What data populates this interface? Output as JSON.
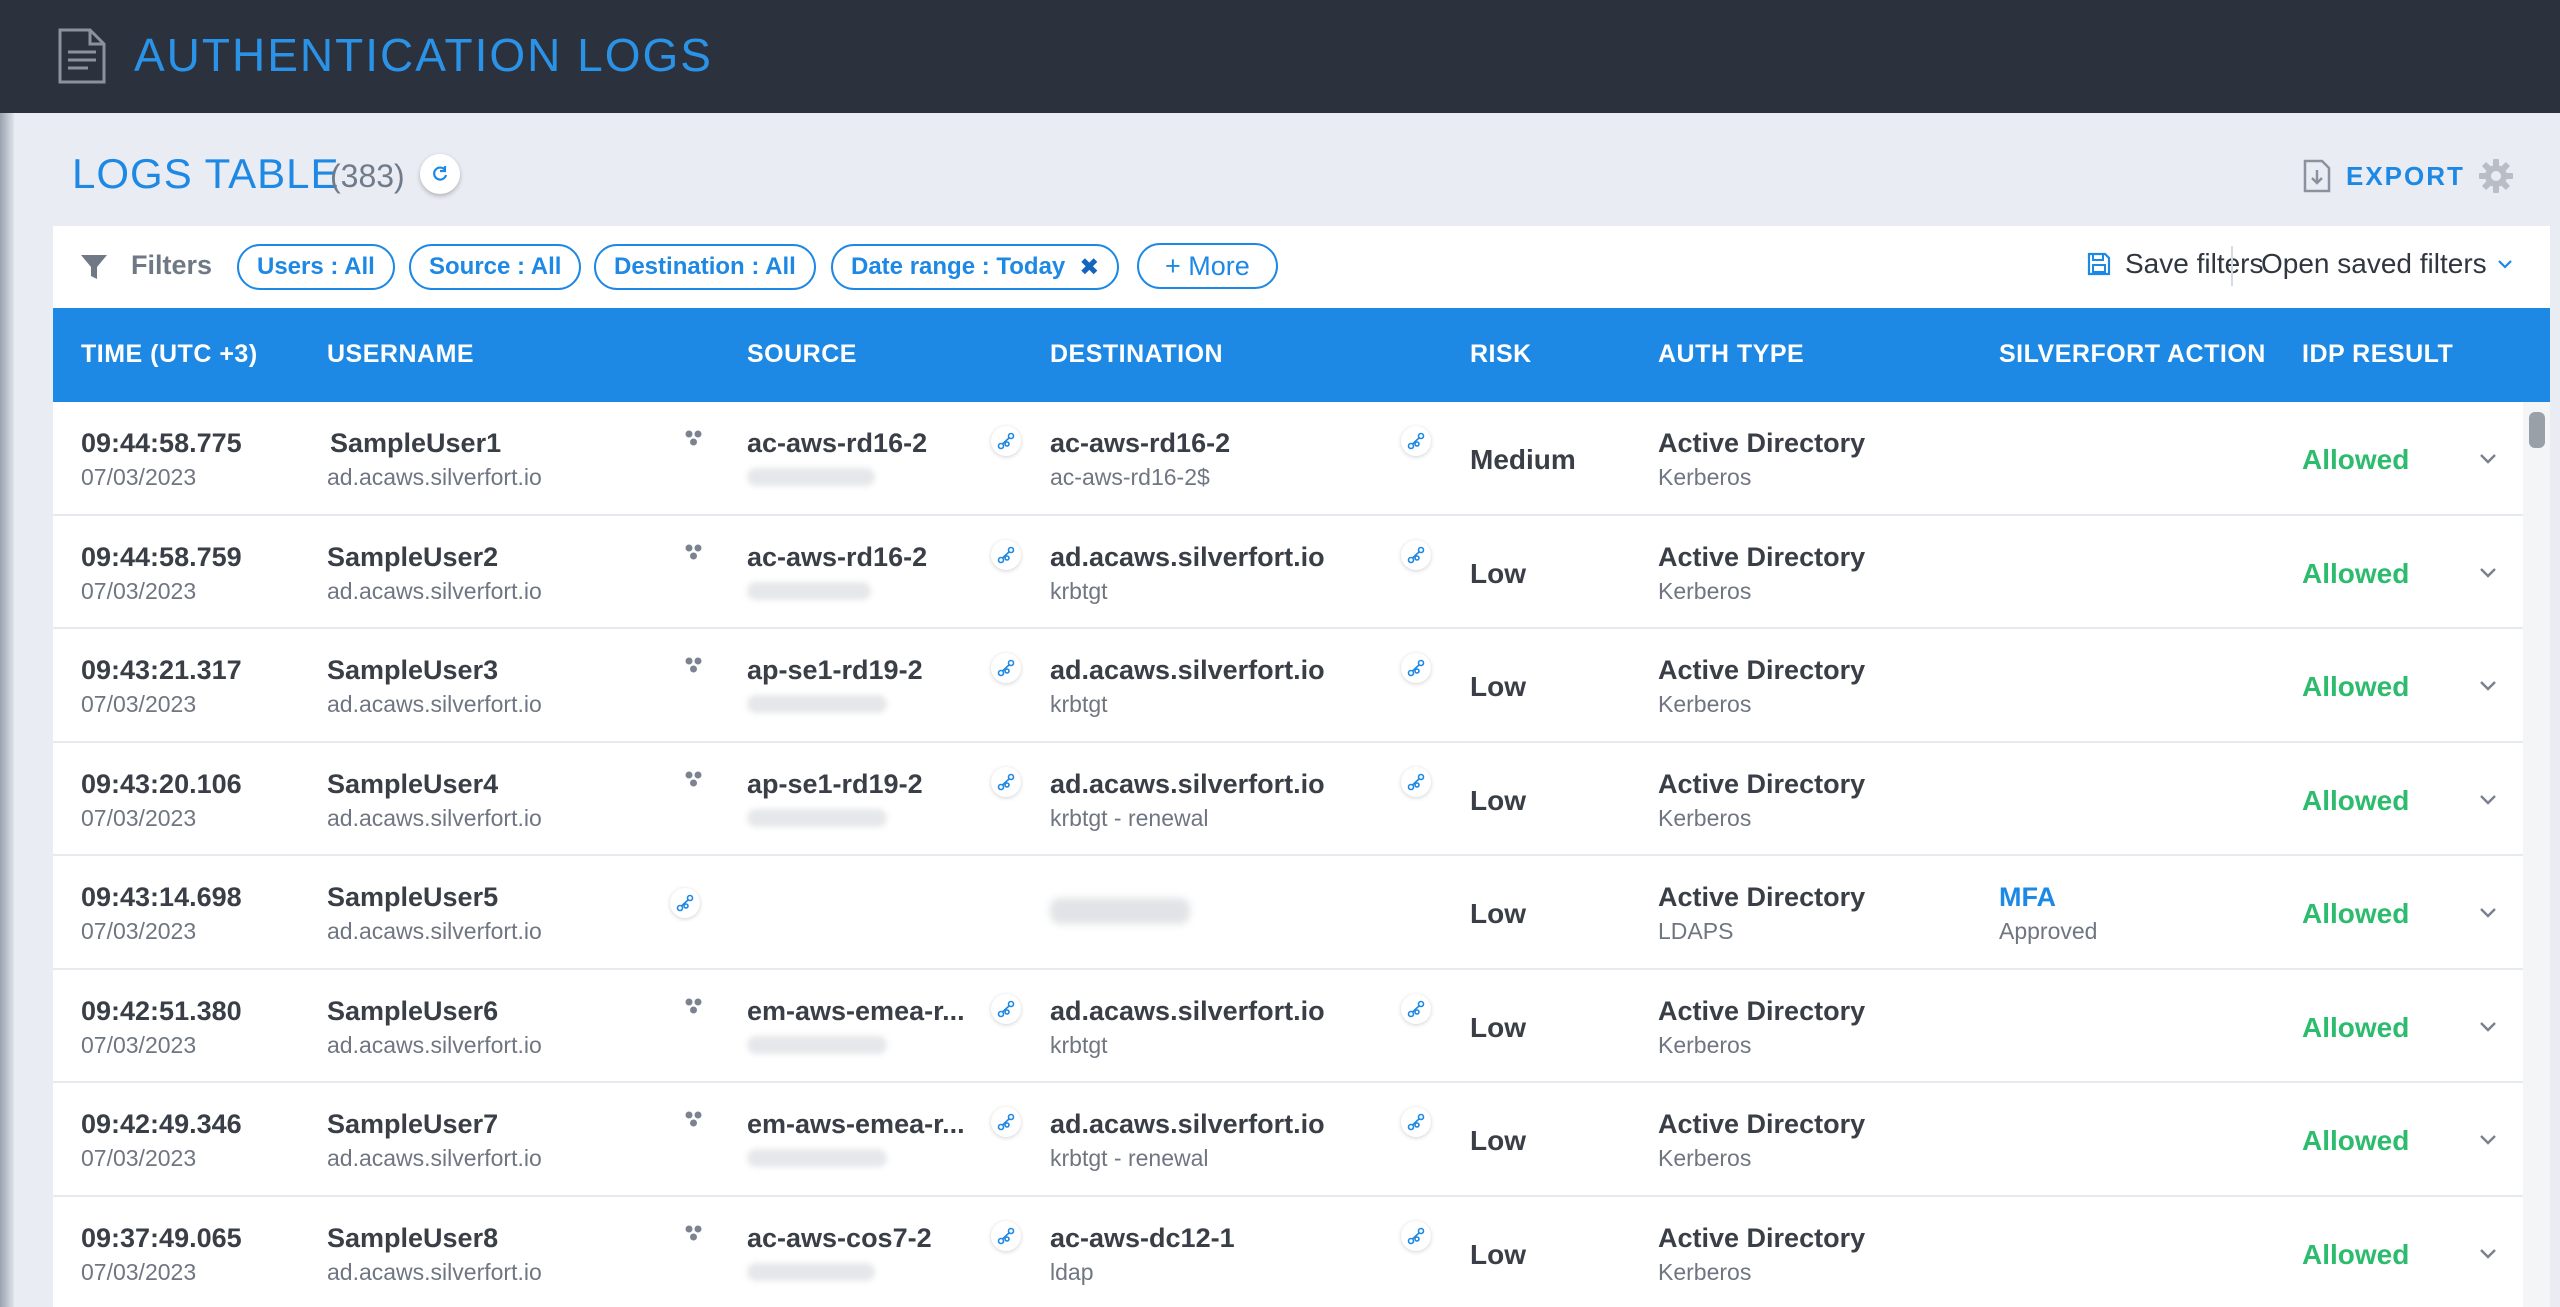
{
  "header": {
    "title": "AUTHENTICATION LOGS"
  },
  "logs": {
    "title": "LOGS TABLE",
    "count": "(383)",
    "export_label": "EXPORT"
  },
  "filters": {
    "label": "Filters",
    "chips": [
      {
        "label": "Users : All"
      },
      {
        "label": "Source : All"
      },
      {
        "label": "Destination : All"
      },
      {
        "label": "Date range : Today",
        "removable": true
      }
    ],
    "more_label": "+ More",
    "save_label": "Save filters",
    "open_saved_label": "Open saved filters"
  },
  "table": {
    "columns": [
      "TIME (UTC +3)",
      "USERNAME",
      "SOURCE",
      "DESTINATION",
      "RISK",
      "AUTH TYPE",
      "SILVERFORT ACTION",
      "IDP RESULT"
    ],
    "rows": [
      {
        "time": "09:44:58.775",
        "date": "07/03/2023",
        "user": "SampleUser1",
        "domain": "ad.acaws.silverfort.io",
        "source": "ac-aws-rd16-2",
        "dest": "ac-aws-rd16-2",
        "dest_sub": "ac-aws-rd16-2$",
        "risk": "Medium",
        "auth": "Active Directory",
        "auth_sub": "Kerberos",
        "action": "",
        "action_sub": "",
        "result": "Allowed"
      },
      {
        "time": "09:44:58.759",
        "date": "07/03/2023",
        "user": "SampleUser2",
        "domain": "ad.acaws.silverfort.io",
        "source": "ac-aws-rd16-2",
        "dest": "ad.acaws.silverfort.io",
        "dest_sub": "krbtgt",
        "risk": "Low",
        "auth": "Active Directory",
        "auth_sub": "Kerberos",
        "action": "",
        "action_sub": "",
        "result": "Allowed"
      },
      {
        "time": "09:43:21.317",
        "date": "07/03/2023",
        "user": "SampleUser3",
        "domain": "ad.acaws.silverfort.io",
        "source": "ap-se1-rd19-2",
        "dest": "ad.acaws.silverfort.io",
        "dest_sub": "krbtgt",
        "risk": "Low",
        "auth": "Active Directory",
        "auth_sub": "Kerberos",
        "action": "",
        "action_sub": "",
        "result": "Allowed"
      },
      {
        "time": "09:43:20.106",
        "date": "07/03/2023",
        "user": "SampleUser4",
        "domain": "ad.acaws.silverfort.io",
        "source": "ap-se1-rd19-2",
        "dest": "ad.acaws.silverfort.io",
        "dest_sub": "krbtgt - renewal",
        "risk": "Low",
        "auth": "Active Directory",
        "auth_sub": "Kerberos",
        "action": "",
        "action_sub": "",
        "result": "Allowed"
      },
      {
        "time": "09:43:14.698",
        "date": "07/03/2023",
        "user": "SampleUser5",
        "domain": "ad.acaws.silverfort.io",
        "source": "",
        "dest": "",
        "dest_sub": "",
        "risk": "Low",
        "auth": "Active Directory",
        "auth_sub": "LDAPS",
        "action": "MFA",
        "action_sub": "Approved",
        "result": "Allowed"
      },
      {
        "time": "09:42:51.380",
        "date": "07/03/2023",
        "user": "SampleUser6",
        "domain": "ad.acaws.silverfort.io",
        "source": "em-aws-emea-r...",
        "dest": "ad.acaws.silverfort.io",
        "dest_sub": "krbtgt",
        "risk": "Low",
        "auth": "Active Directory",
        "auth_sub": "Kerberos",
        "action": "",
        "action_sub": "",
        "result": "Allowed"
      },
      {
        "time": "09:42:49.346",
        "date": "07/03/2023",
        "user": "SampleUser7",
        "domain": "ad.acaws.silverfort.io",
        "source": "em-aws-emea-r...",
        "dest": "ad.acaws.silverfort.io",
        "dest_sub": "krbtgt - renewal",
        "risk": "Low",
        "auth": "Active Directory",
        "auth_sub": "Kerberos",
        "action": "",
        "action_sub": "",
        "result": "Allowed"
      },
      {
        "time": "09:37:49.065",
        "date": "07/03/2023",
        "user": "SampleUser8",
        "domain": "ad.acaws.silverfort.io",
        "source": "ac-aws-cos7-2",
        "dest": "ac-aws-dc12-1",
        "dest_sub": "ldap",
        "risk": "Low",
        "auth": "Active Directory",
        "auth_sub": "Kerberos",
        "action": "",
        "action_sub": "",
        "result": "Allowed"
      }
    ]
  },
  "colors": {
    "accent": "#1e88e5",
    "topbar": "#2b323d",
    "allowed": "#2dbb6d"
  },
  "icons": [
    "document-icon",
    "refresh-icon",
    "export-icon",
    "gear-icon",
    "funnel-icon",
    "save-icon",
    "chevron-down-icon",
    "group-icon",
    "graph-link-icon"
  ]
}
